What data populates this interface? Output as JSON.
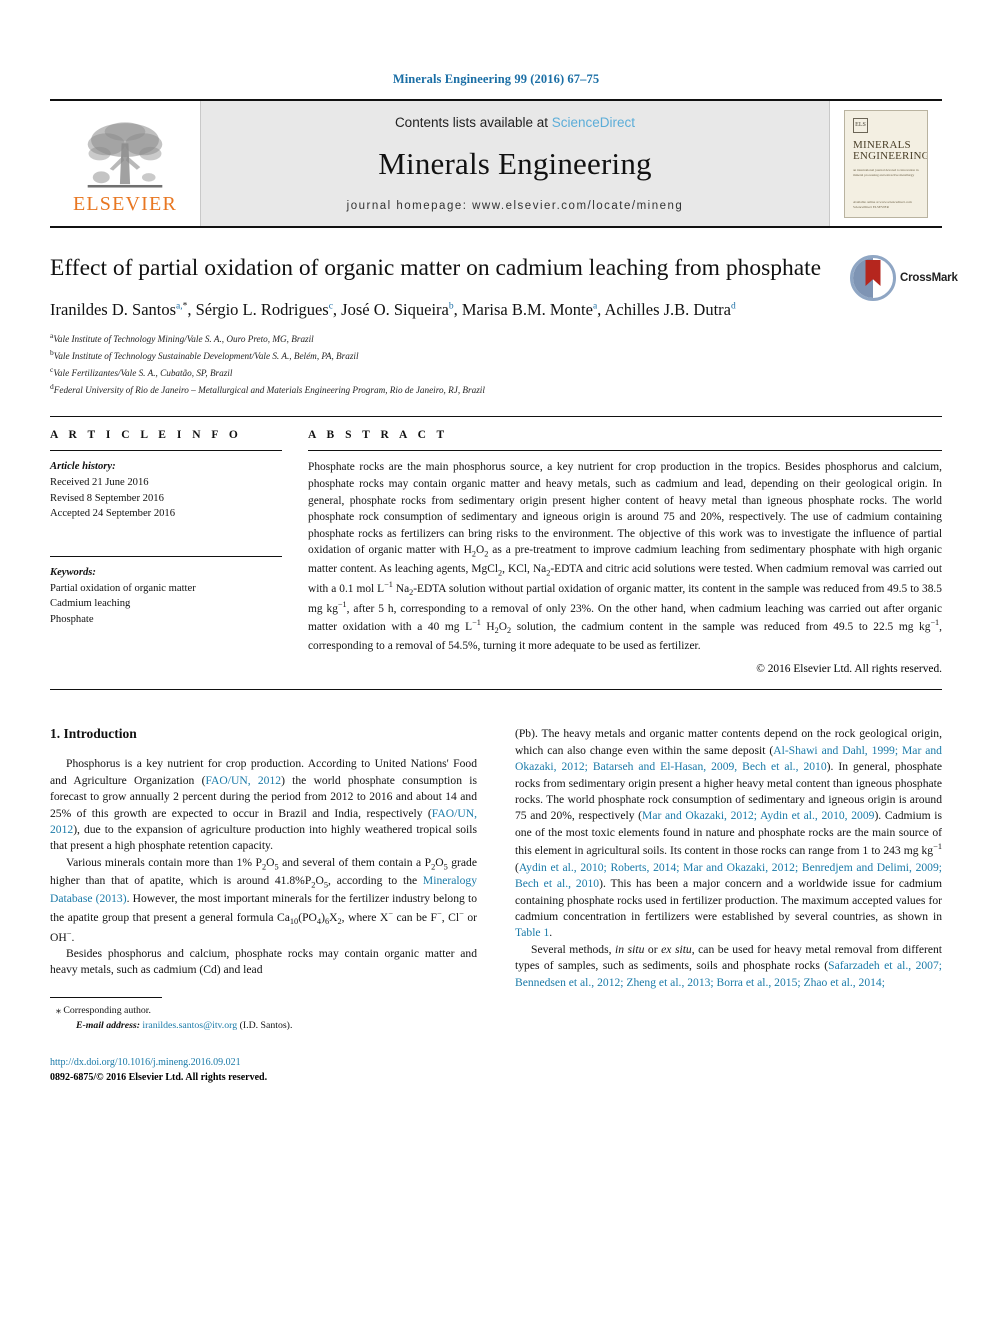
{
  "running_head": "Minerals Engineering 99 (2016) 67–75",
  "masthead": {
    "publisher_name": "ELSEVIER",
    "contents_prefix": "Contents lists available at ",
    "contents_link": "ScienceDirect",
    "journal_name": "Minerals Engineering",
    "homepage": "journal homepage: www.elsevier.com/locate/mineng",
    "cover": {
      "line1": "MINERALS",
      "line2": "ENGINEERING",
      "subtitle": "an international journal devoted to innovation in mineral processing and extractive metallurgy",
      "footer": "Available online at www.sciencedirect.com  ScienceDirect  ELSEVIER"
    }
  },
  "article": {
    "title": "Effect of partial oxidation of organic matter on cadmium leaching from phosphate",
    "crossmark_label": "CrossMark",
    "authors_html": "Iranildes D. Santos<sup>a,</sup><sup class=\"star\">*</sup>, Sérgio L. Rodrigues<sup>c</sup>, José O. Siqueira<sup>b</sup>, Marisa B.M. Monte<sup>a</sup>, Achilles J.B. Dutra<sup>d</sup>",
    "affiliations": [
      {
        "marker": "a",
        "text": "Vale Institute of Technology Mining/Vale S. A., Ouro Preto, MG, Brazil"
      },
      {
        "marker": "b",
        "text": "Vale Institute of Technology Sustainable Development/Vale S. A., Belém, PA, Brazil"
      },
      {
        "marker": "c",
        "text": "Vale Fertilizantes/Vale S. A., Cubatão, SP, Brazil"
      },
      {
        "marker": "d",
        "text": "Federal University of Rio de Janeiro – Metallurgical and Materials Engineering Program, Rio de Janeiro, RJ, Brazil"
      }
    ]
  },
  "article_info": {
    "heading": "A R T I C L E    I N F O",
    "history_label": "Article history:",
    "history": [
      "Received 21 June 2016",
      "Revised 8 September 2016",
      "Accepted 24 September 2016"
    ],
    "keywords_label": "Keywords:",
    "keywords": [
      "Partial oxidation of organic matter",
      "Cadmium leaching",
      "Phosphate"
    ]
  },
  "abstract": {
    "heading": "A B S T R A C T",
    "text_html": "Phosphate rocks are the main phosphorus source, a key nutrient for crop production in the tropics. Besides phosphorus and calcium, phosphate rocks may contain organic matter and heavy metals, such as cadmium and lead, depending on their geological origin. In general, phosphate rocks from sedimentary origin present higher content of heavy metal than igneous phosphate rocks. The world phosphate rock consumption of sedimentary and igneous origin is around 75 and 20%, respectively. The use of cadmium containing phosphate rocks as fertilizers can bring risks to the environment. The objective of this work was to investigate the influence of partial oxidation of organic matter with H<sub>2</sub>O<sub>2</sub> as a pre-treatment to improve cadmium leaching from sedimentary phosphate with high organic matter content. As leaching agents, MgCl<sub>2</sub>, KCl, Na<sub>2</sub>-EDTA and citric acid solutions were tested. When cadmium removal was carried out with a 0.1 mol L<sup>−1</sup> Na<sub>2</sub>-EDTA solution without partial oxidation of organic matter, its content in the sample was reduced from 49.5 to 38.5 mg kg<sup>−1</sup>, after 5 h, corresponding to a removal of only 23%. On the other hand, when cadmium leaching was carried out after organic matter oxidation with a 40 mg L<sup>−1</sup> H<sub>2</sub>O<sub>2</sub> solution, the cadmium content in the sample was reduced from 49.5 to 22.5 mg kg<sup>−1</sup>, corresponding to a removal of 54.5%, turning it more adequate to be used as fertilizer.",
    "copyright": "© 2016 Elsevier Ltd. All rights reserved."
  },
  "introduction": {
    "heading": "1. Introduction",
    "left_paragraphs_html": [
      "Phosphorus is a key nutrient for crop production. According to United Nations' Food and Agriculture Organization (<span class=\"ref\">FAO/UN, 2012</span>) the world phosphate consumption is forecast to grow annually 2 percent during the period from 2012 to 2016 and about 14 and 25% of this growth are expected to occur in Brazil and India, respectively (<span class=\"ref\">FAO/UN, 2012</span>), due to the expansion of agriculture production into highly weathered tropical soils that present a high phosphate retention capacity.",
      "Various minerals contain more than 1% P<sub>2</sub>O<sub>5</sub> and several of them contain a P<sub>2</sub>O<sub>5</sub> grade higher than that of apatite, which is around 41.8%P<sub>2</sub>O<sub>5</sub>, according to the <span class=\"ref\">Mineralogy Database (2013)</span>. However, the most important minerals for the fertilizer industry belong to the apatite group that present a general formula Ca<sub>10</sub>(PO<sub>4</sub>)<sub>6</sub>X<sub>2</sub>, where X<sup>−</sup> can be F<sup>−</sup>, Cl<sup>−</sup> or OH<sup>−</sup>.",
      "Besides phosphorus and calcium, phosphate rocks may contain organic matter and heavy metals, such as cadmium (Cd) and lead"
    ],
    "right_paragraphs_html": [
      "(Pb). The heavy metals and organic matter contents depend on the rock geological origin, which can also change even within the same deposit (<span class=\"ref\">Al-Shawi and Dahl, 1999; Mar and Okazaki, 2012; Batarseh and El-Hasan, 2009, Bech et al., 2010</span>). In general, phosphate rocks from sedimentary origin present a higher heavy metal content than igneous phosphate rocks. The world phosphate rock consumption of sedimentary and igneous origin is around 75 and 20%, respectively (<span class=\"ref\">Mar and Okazaki, 2012; Aydin et al., 2010, 2009</span>). Cadmium is one of the most toxic elements found in nature and phosphate rocks are the main source of this element in agricultural soils. Its content in those rocks can range from 1 to 243 mg kg<sup>−1</sup> (<span class=\"ref\">Aydin et al., 2010; Roberts, 2014; Mar and Okazaki, 2012; Benredjem and Delimi, 2009; Bech et al., 2010</span>). This has been a major concern and a worldwide issue for cadmium containing phosphate rocks used in fertilizer production. The maximum accepted values for cadmium concentration in fertilizers were established by several countries, as shown in <span class=\"ref\">Table 1</span>.",
      "Several methods, <i>in situ</i> or <i>ex situ</i>, can be used for heavy metal removal from different types of samples, such as sediments, soils and phosphate rocks (<span class=\"ref\">Safarzadeh et al., 2007; Bennedsen et al., 2012; Zheng et al., 2013; Borra et al., 2015; Zhao et al., 2014;</span>"
    ]
  },
  "footer": {
    "corresponding_marker": "⁎",
    "corresponding_label": "Corresponding author.",
    "email_label": "E-mail address:",
    "email": "iranildes.santos@itv.org",
    "email_owner": "(I.D. Santos).",
    "doi": "http://dx.doi.org/10.1016/j.mineng.2016.09.021",
    "issn_line": "0892-6875/© 2016 Elsevier Ltd. All rights reserved."
  }
}
